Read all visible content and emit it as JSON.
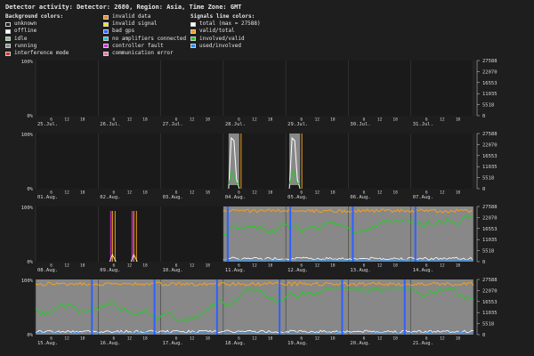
{
  "title": "Detector activity: Detector: 2680, Region: Asia, Time Zone: GMT",
  "legend": {
    "background_title": "Background colors:",
    "background_col1": [
      {
        "label": "unknown",
        "color": "#1e1e1e"
      },
      {
        "label": "offline",
        "color": "#ffffff"
      },
      {
        "label": "idle",
        "color": "#8fbc8f"
      },
      {
        "label": "running",
        "color": "#888888"
      },
      {
        "label": "interference mode",
        "color": "#d03030"
      }
    ],
    "background_col2": [
      {
        "label": "invalid data",
        "color": "#e88a2e"
      },
      {
        "label": "invalid signal",
        "color": "#f2e600"
      },
      {
        "label": "bad gps",
        "color": "#3060ff"
      },
      {
        "label": "no amplifiers connected",
        "color": "#20c0d0"
      },
      {
        "label": "controller fault",
        "color": "#d030d0"
      },
      {
        "label": "communication error",
        "color": "#f070b0"
      }
    ],
    "signals_title": "Signals line colors:",
    "signals": [
      {
        "label": "total (max = 27588)",
        "color": "#ffffff"
      },
      {
        "label": "valid/total",
        "color": "#f0a020"
      },
      {
        "label": "involved/valid",
        "color": "#22cc22"
      },
      {
        "label": "used/involved",
        "color": "#2090ff"
      }
    ]
  },
  "axis": {
    "left_ticks": [
      "100%",
      "0%"
    ],
    "right_ticks": [
      "27588",
      "22070",
      "16553",
      "11035",
      "5518",
      "0"
    ],
    "hour_ticks": [
      "6",
      "12",
      "18"
    ]
  },
  "panels": [
    {
      "days": [
        "25.Jul.",
        "26.Jul.",
        "27.Jul.",
        "28.Jul.",
        "29.Jul.",
        "30.Jul.",
        "31.Jul."
      ],
      "running_from": null
    },
    {
      "days": [
        "01.Aug.",
        "02.Aug.",
        "03.Aug.",
        "04.Aug.",
        "05.Aug.",
        "06.Aug.",
        "07.Aug."
      ],
      "running_from": null
    },
    {
      "days": [
        "08.Aug.",
        "09.Aug.",
        "10.Aug.",
        "11.Aug.",
        "12.Aug.",
        "13.Aug.",
        "14.Aug."
      ],
      "running_from": "11.Aug."
    },
    {
      "days": [
        "15.Aug.",
        "16.Aug.",
        "17.Aug.",
        "18.Aug.",
        "19.Aug.",
        "20.Aug.",
        "21.Aug."
      ],
      "running_from": "15.Aug."
    }
  ],
  "colors": {
    "background": "#1e1e1e",
    "plot_bg": "#1a1a1a",
    "running": "#888888",
    "grid": "#3c3c3c",
    "axis_text": "#d8d8d8"
  }
}
